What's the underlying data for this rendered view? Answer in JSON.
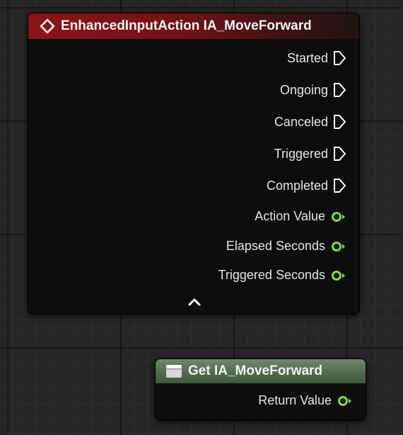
{
  "event_node": {
    "title": "EnhancedInputAction IA_MoveForward",
    "header_color": "#8a1418",
    "exec_pins": [
      {
        "label": "Started"
      },
      {
        "label": "Ongoing"
      },
      {
        "label": "Canceled"
      },
      {
        "label": "Triggered"
      },
      {
        "label": "Completed"
      }
    ],
    "data_pins": [
      {
        "label": "Action Value"
      },
      {
        "label": "Elapsed Seconds"
      },
      {
        "label": "Triggered Seconds"
      }
    ],
    "data_pin_color": "#7ee03a",
    "collapse_icon": "chevron-up-icon"
  },
  "get_node": {
    "title": "Get IA_MoveForward",
    "header_color": "#5b7a58",
    "pins": [
      {
        "label": "Return Value"
      }
    ]
  }
}
